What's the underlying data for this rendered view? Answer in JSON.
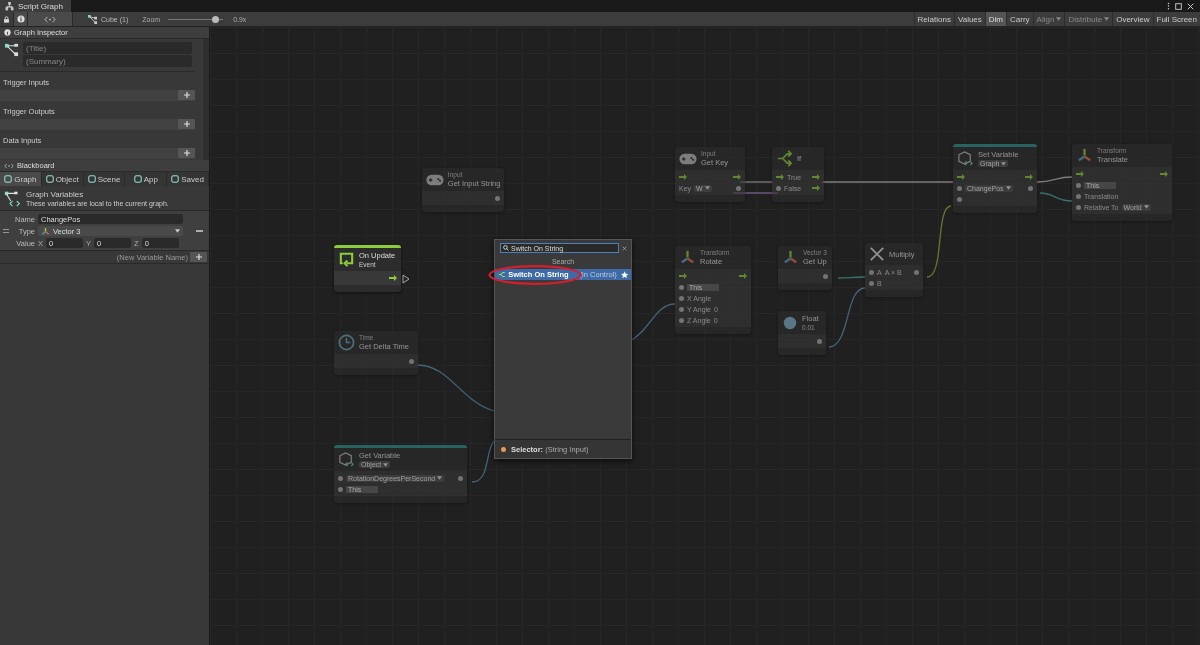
{
  "window": {
    "title": "Script Graph"
  },
  "toolbar": {
    "breadcrumb": "Cube (1)",
    "zoom_label": "Zoom",
    "zoom": {
      "level": 0.85,
      "reading": "0.9x"
    },
    "buttons": [
      {
        "label": "Relations",
        "selected": false,
        "disabled": false,
        "dropdown": false
      },
      {
        "label": "Values",
        "selected": false,
        "disabled": false,
        "dropdown": false
      },
      {
        "label": "Dim",
        "selected": true,
        "disabled": false,
        "dropdown": false
      },
      {
        "label": "Carry",
        "selected": false,
        "disabled": false,
        "dropdown": false
      },
      {
        "label": "Align",
        "selected": false,
        "disabled": true,
        "dropdown": true
      },
      {
        "label": "Distribute",
        "selected": false,
        "disabled": true,
        "dropdown": true
      },
      {
        "label": "Overview",
        "selected": false,
        "disabled": false,
        "dropdown": false
      },
      {
        "label": "Full Screen",
        "selected": false,
        "disabled": false,
        "dropdown": false
      }
    ]
  },
  "inspector": {
    "title": "Graph Inspector",
    "title_placeholder": "(Title)",
    "summary_placeholder": "(Summary)",
    "sections": [
      "Trigger Inputs",
      "Trigger Outputs",
      "Data Inputs"
    ]
  },
  "blackboard": {
    "title": "Blackboard",
    "tabs": [
      {
        "label": "Graph",
        "selected": true
      },
      {
        "label": "Object",
        "selected": false
      },
      {
        "label": "Scene",
        "selected": false
      },
      {
        "label": "App",
        "selected": false
      },
      {
        "label": "Saved",
        "selected": false
      }
    ],
    "heading": "Graph Variables",
    "description": "These variables are local to the current graph.",
    "variable": {
      "name_label": "Name",
      "name": "ChangePos",
      "type_label": "Type",
      "type": "Vector 3",
      "value_label": "Value",
      "components": [
        {
          "axis": "X",
          "value": "0"
        },
        {
          "axis": "Y",
          "value": "0"
        },
        {
          "axis": "Z",
          "value": "0"
        }
      ]
    },
    "new_variable_placeholder": "(New Variable Name)"
  },
  "nodes": [
    {
      "kind": "gamepad",
      "category": "Input",
      "title": "Get Input String",
      "dimmed": true,
      "rows": [
        {
          "kind": "output"
        }
      ]
    },
    {
      "kind": "event",
      "title": "On Update",
      "subtitle": "Event",
      "dimmed": false,
      "rows": [
        {
          "kind": "trigger"
        }
      ]
    },
    {
      "kind": "clock",
      "category": "Time",
      "title": "Get Delta Time",
      "dimmed": true,
      "rows": [
        {
          "kind": "output"
        }
      ]
    },
    {
      "kind": "variable",
      "title": "Get Variable",
      "dropdown": "Object",
      "dimmed": true,
      "rows": [
        {
          "kind": "through",
          "dropdown": "RotationDegreesPerSecond"
        },
        {
          "kind": "input",
          "field": "This"
        }
      ]
    },
    {
      "kind": "gamepad",
      "category": "Input",
      "title": "Get Key",
      "dimmed": true,
      "rows": [
        {
          "kind": "flow"
        },
        {
          "kind": "output",
          "label": "Key",
          "dropdown": "W"
        }
      ]
    },
    {
      "kind": "branch",
      "title": "If",
      "dimmed": true,
      "rows": [
        {
          "kind": "flow",
          "label": "True"
        },
        {
          "kind": "branch",
          "label": "False"
        }
      ]
    },
    {
      "kind": "variable",
      "title": "Set Variable",
      "dropdown": "Graph",
      "dimmed": true,
      "rows": [
        {
          "kind": "flow"
        },
        {
          "kind": "through",
          "dropdown": "ChangePos"
        },
        {
          "kind": "input"
        }
      ]
    },
    {
      "kind": "transform",
      "category": "Transform",
      "title": "Translate",
      "dimmed": true,
      "rows": [
        {
          "kind": "flow"
        },
        {
          "kind": "input",
          "field": "This"
        },
        {
          "kind": "input",
          "label": "Translation"
        },
        {
          "kind": "input",
          "label": "Relative To",
          "dropdown": "World"
        }
      ]
    },
    {
      "kind": "transform",
      "category": "Transform",
      "title": "Rotate",
      "dimmed": true,
      "rows": [
        {
          "kind": "flow"
        },
        {
          "kind": "input",
          "field": "This"
        },
        {
          "kind": "input",
          "label": "X Angle"
        },
        {
          "kind": "input",
          "label": "Y Angle",
          "value": "0"
        },
        {
          "kind": "input",
          "label": "Z Angle",
          "value": "0"
        }
      ]
    },
    {
      "kind": "vector",
      "category": "Vector 3",
      "title": "Get Up",
      "dimmed": true,
      "rows": [
        {
          "kind": "output"
        }
      ]
    },
    {
      "kind": "float",
      "title": "Float",
      "subtitle": "0.01",
      "dimmed": true,
      "rows": [
        {
          "kind": "output"
        }
      ]
    },
    {
      "kind": "multiply",
      "title": "Multiply",
      "dimmed": true,
      "rows": [
        {
          "kind": "through",
          "label": "A",
          "value": "A × B"
        },
        {
          "kind": "input",
          "label": "B"
        }
      ]
    }
  ],
  "search": {
    "query": "Switch On String",
    "heading": "Search",
    "results": [
      {
        "label": "Switch On String",
        "hint": "(in Control)",
        "selected": true,
        "favorite": true
      }
    ],
    "footer": "**Selector:** (String Input)"
  }
}
